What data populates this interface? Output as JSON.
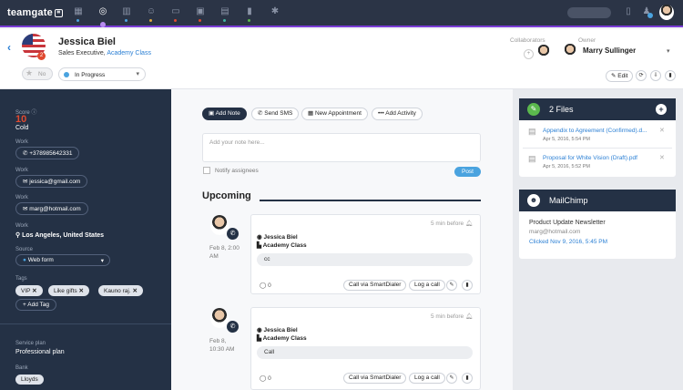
{
  "brand": {
    "name": "teamgate"
  },
  "colors": {
    "accent": "#7a3dd6",
    "dark_nav": "#2b3446",
    "sidebar": "#243145",
    "link": "#2a7fd4",
    "post_button": "#4aa3df",
    "score": "#e0492f",
    "files_icon": "#5bb84d"
  },
  "nav": {
    "icons": [
      "dashboard-icon",
      "leads-icon",
      "target-icon",
      "deals-icon",
      "people-icon",
      "companies-icon",
      "calendar-icon",
      "tasks-icon",
      "reports-icon",
      "settings-icon"
    ]
  },
  "contact": {
    "name": "Jessica Biel",
    "role": "Sales Executive, ",
    "company": "Academy Class",
    "badge_count": "2",
    "status": "In Progress",
    "no_label": "No"
  },
  "collaborators": {
    "label": "Collaborators"
  },
  "owner": {
    "label": "Owner",
    "name": "Marry Sullinger"
  },
  "header_actions": {
    "edit": "Edit"
  },
  "sidebar": {
    "score_label": "Score",
    "score_value": "10",
    "score_state": "Cold",
    "work1_label": "Work",
    "phone": "+378985642331",
    "work2_label": "Work",
    "email1": "jessica@gmail.com",
    "work3_label": "Work",
    "email2": "marg@hotmail.com",
    "work4_label": "Work",
    "location": "Los Angeles, United States",
    "source_label": "Source",
    "source": "Web form",
    "tags_label": "Tags",
    "tags": [
      "VIP",
      "Like gifts",
      "Kauno raj."
    ],
    "add_tag": "Add Tag",
    "service_label": "Service plan",
    "service": "Professional plan",
    "bank_label": "Bank",
    "bank": "Lloyds"
  },
  "activity_tabs": {
    "add_note": "Add Note",
    "send_sms": "Send SMS",
    "new_appointment": "New Appointment",
    "add_activity": "Add Activity"
  },
  "note": {
    "placeholder": "Add your note here...",
    "notify": "Notify assignees",
    "post": "Post"
  },
  "upcoming": {
    "title": "Upcoming",
    "items": [
      {
        "date": "Feb 8, 2:00",
        "period": "AM",
        "time_ago": "5 min before",
        "contact": "Jessica Biel",
        "company": "Academy Class",
        "note": "cc",
        "comments": "0",
        "call_btn": "Call via SmartDialer",
        "log_btn": "Log a call"
      },
      {
        "date": "Feb 8,",
        "period": "10:30 AM",
        "time_ago": "5 min before",
        "contact": "Jessica Biel",
        "company": "Academy Class",
        "note": "Call",
        "comments": "0",
        "call_btn": "Call via SmartDialer",
        "log_btn": "Log a call"
      }
    ]
  },
  "files": {
    "title": "2 Files",
    "items": [
      {
        "name": "Appendix to Agreement (Confirmed).d...",
        "date": "Apr 5, 2016, 5:54 PM"
      },
      {
        "name": "Proposal for White Vision (Draft).pdf",
        "date": "Apr 5, 2016, 5:52 PM"
      }
    ]
  },
  "mailchimp": {
    "title": "MailChimp",
    "campaign": "Product Update Newsletter",
    "email": "marg@hotmail.com",
    "clicked": "Clicked Nov 9, 2016, 5:45 PM"
  }
}
